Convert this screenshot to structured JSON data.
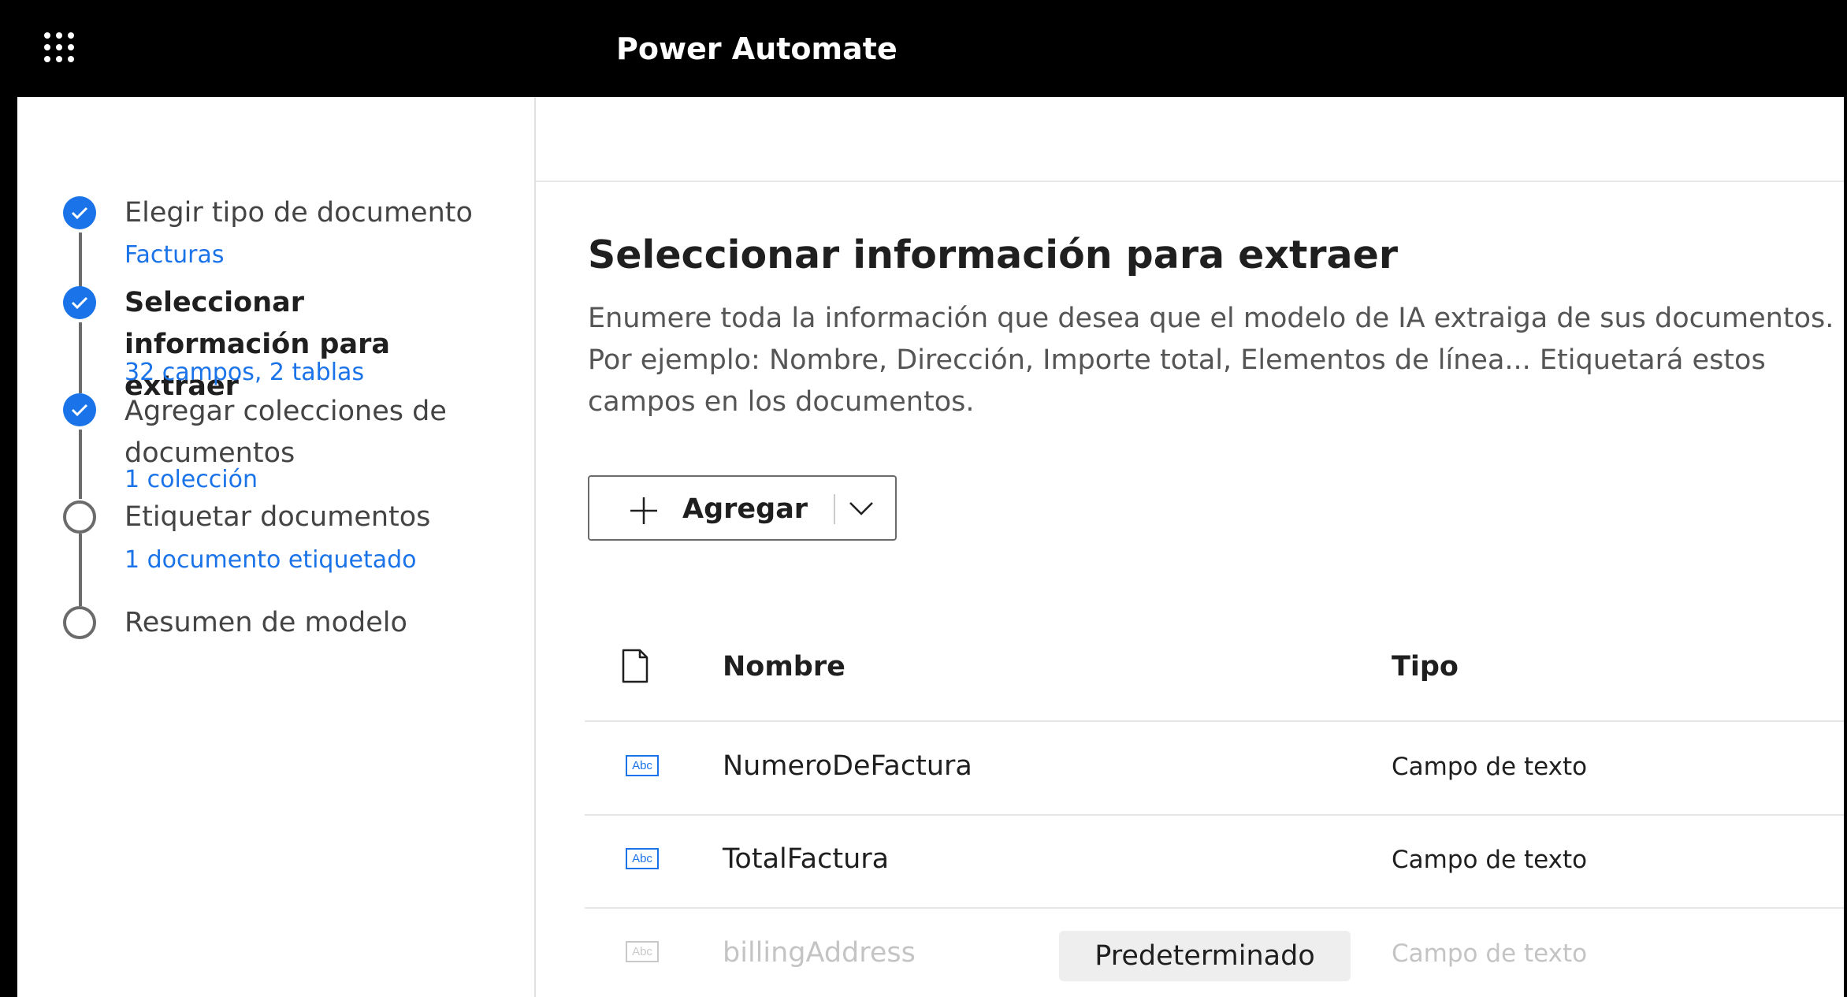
{
  "header": {
    "app_title": "Power Automate",
    "waffle_icon": "waffle-icon"
  },
  "colors": {
    "accent": "#1a73e8",
    "topbar": "#000000"
  },
  "steps": [
    {
      "title": "Elegir tipo de documento",
      "subtitle": "Facturas",
      "status": "done"
    },
    {
      "title": "Seleccionar información para extraer",
      "subtitle": "32 campos, 2 tablas",
      "status": "current"
    },
    {
      "title": "Agregar colecciones de documentos",
      "subtitle": "1 colección",
      "status": "done"
    },
    {
      "title": "Etiquetar documentos",
      "subtitle": "1 documento etiquetado",
      "status": "pending"
    },
    {
      "title": "Resumen de modelo",
      "subtitle": "",
      "status": "pending"
    }
  ],
  "main": {
    "title": "Seleccionar información para extraer",
    "description": "Enumere toda la información que desea que el modelo de IA extraiga de sus documentos. Por ejemplo: Nombre, Dirección, Importe total, Elementos de línea... Etiquetará estos campos en los documentos.",
    "add_button": {
      "label": "Agregar",
      "icon": "plus-icon",
      "dropdown_icon": "chevron-down-icon"
    }
  },
  "table": {
    "columns": [
      "Nombre",
      "Tipo"
    ],
    "rows": [
      {
        "icon": "Abc",
        "name": "NumeroDeFactura",
        "type": "Campo de texto",
        "disabled": false,
        "badge": ""
      },
      {
        "icon": "Abc",
        "name": "TotalFactura",
        "type": "Campo de texto",
        "disabled": false,
        "badge": ""
      },
      {
        "icon": "Abc",
        "name": "billingAddress",
        "type": "Campo de texto",
        "disabled": true,
        "badge": "Predeterminado"
      }
    ]
  }
}
